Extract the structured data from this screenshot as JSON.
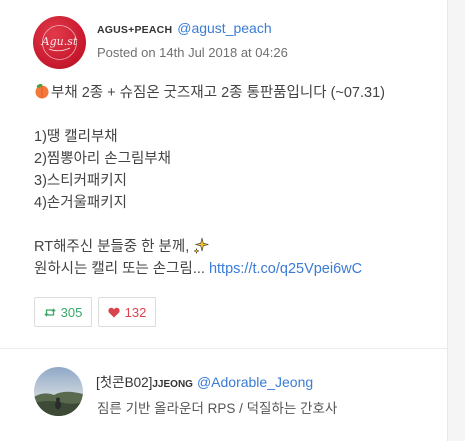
{
  "tweet": {
    "author": {
      "name": "AGUS+PEACH",
      "handle": "@agust_peach",
      "avatar_text": "Agu.st"
    },
    "posted": "Posted on 14th Jul 2018 at 04:26",
    "lines": {
      "l1": "부채 2종 + 슈짐온 굿즈재고 2종 통판품입니다 (~07.31)",
      "l2": "1)땡 캘리부채",
      "l3": "2)찜뽕아리 손그림부채",
      "l4": "3)스티커패키지",
      "l5": "4)손거울패키지",
      "l6": "RT해주신 분들중 한 분께, ",
      "l7": "원하시는 캘리 또는 손그림... ",
      "link": "https://t.co/q25Vpei6wC"
    },
    "retweets": "305",
    "likes": "132"
  },
  "mention_user": {
    "name_prefix": "[첫콘B02]",
    "name_suffix": "JJEONG",
    "handle": "@Adorable_Jeong",
    "bio": "짐른 기반 올라운더 RPS / 덕질하는 간호사"
  },
  "icons": {
    "peach": "peach-emoji",
    "sparkles": "sparkles-emoji",
    "retweet": "retweet-icon",
    "heart": "heart-icon"
  },
  "colors": {
    "link": "#3a7bd5",
    "retweet": "#3aa86b",
    "like": "#d9434b"
  }
}
